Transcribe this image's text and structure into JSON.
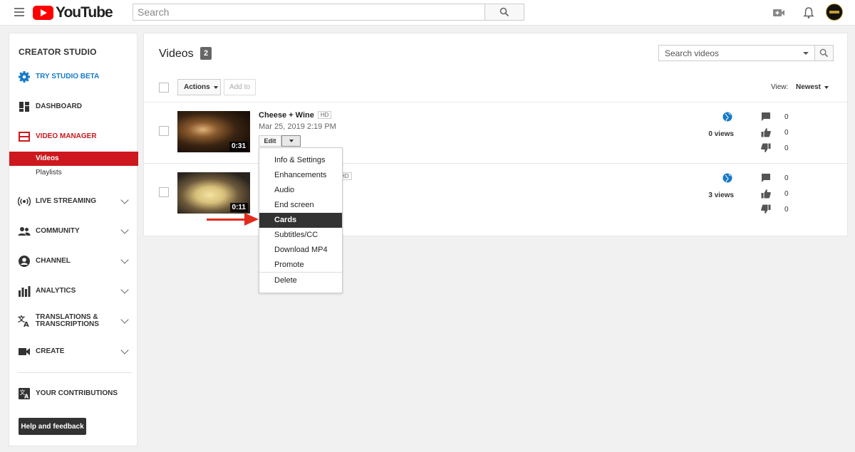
{
  "header": {
    "logo_text": "YouTube",
    "search_placeholder": "Search"
  },
  "sidebar": {
    "title": "CREATOR STUDIO",
    "try_beta": "TRY STUDIO BETA",
    "dashboard": "DASHBOARD",
    "video_manager": "VIDEO MANAGER",
    "sub_videos": "Videos",
    "sub_playlists": "Playlists",
    "live_streaming": "LIVE STREAMING",
    "community": "COMMUNITY",
    "channel": "CHANNEL",
    "analytics": "ANALYTICS",
    "translations_line1": "TRANSLATIONS &",
    "translations_line2": "TRANSCRIPTIONS",
    "create": "CREATE",
    "your_contributions": "YOUR CONTRIBUTIONS",
    "help_feedback": "Help and feedback"
  },
  "main": {
    "title": "Videos",
    "count": "2",
    "search_videos_placeholder": "Search videos",
    "actions_label": "Actions",
    "add_to_label": "Add to",
    "view_label": "View:",
    "view_value": "Newest"
  },
  "videos": [
    {
      "title": "Cheese + Wine",
      "hd": "HD",
      "date": "Mar 25, 2019 2:19 PM",
      "duration": "0:31",
      "views": "0 views",
      "comments": "0",
      "likes": "0",
      "dislikes": "0",
      "edit_label": "Edit"
    },
    {
      "hd": "HD",
      "duration": "0:11",
      "views": "3 views",
      "comments": "0",
      "likes": "0",
      "dislikes": "0"
    }
  ],
  "edit_menu": {
    "items": [
      "Info & Settings",
      "Enhancements",
      "Audio",
      "End screen",
      "Cards",
      "Subtitles/CC",
      "Download MP4",
      "Promote"
    ],
    "delete": "Delete",
    "highlighted": "Cards"
  },
  "colors": {
    "brand_red": "#ff0000",
    "studio_red": "#cc181e",
    "link_blue": "#167ac6",
    "annotation_arrow": "#e22b1c"
  }
}
